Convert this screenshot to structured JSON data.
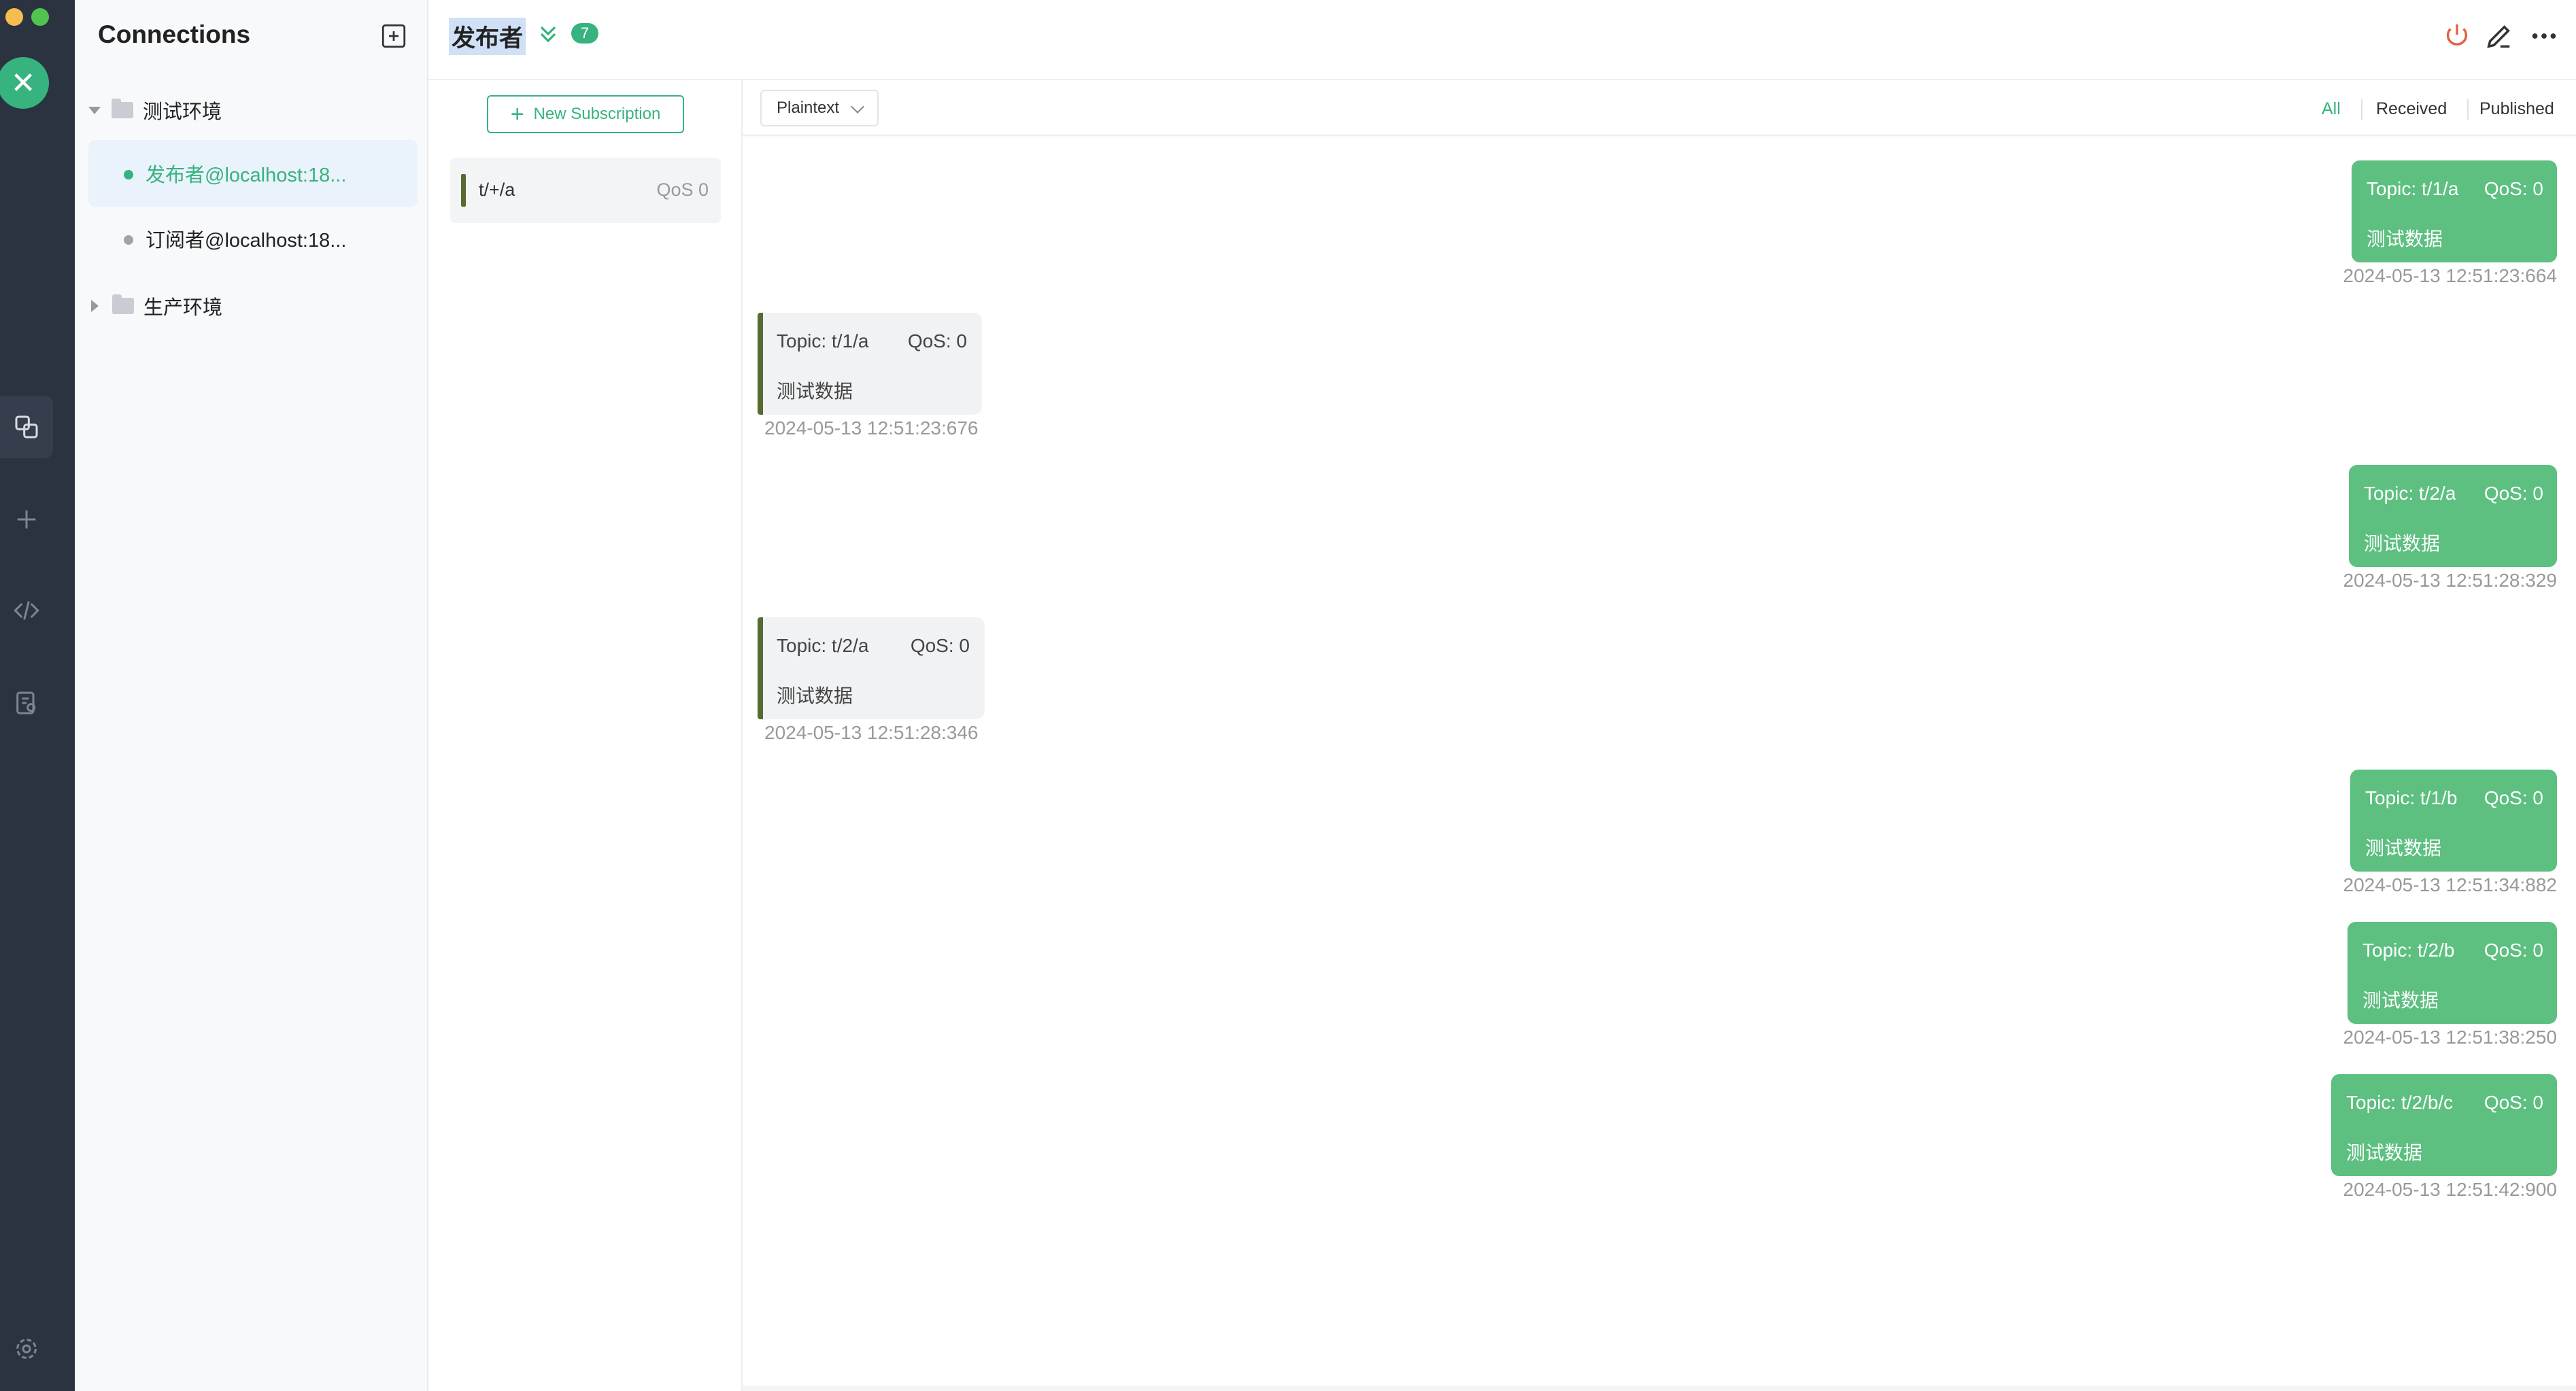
{
  "sidebar": {
    "logo": "✕",
    "icons": [
      "connections-icon",
      "plus-icon",
      "script-icon",
      "log-icon",
      "settings-icon"
    ]
  },
  "connections": {
    "title": "Connections",
    "groups": [
      {
        "name": "测试环境",
        "expanded": true
      },
      {
        "name": "生产环境",
        "expanded": false
      }
    ],
    "items": [
      {
        "name": "发布者@localhost:18...",
        "status": "connected",
        "active": true
      },
      {
        "name": "订阅者@localhost:18...",
        "status": "disconnected",
        "active": false
      }
    ]
  },
  "header": {
    "title": "发布者",
    "count": "7"
  },
  "subscriptions": {
    "new_label": "New Subscription",
    "items": [
      {
        "topic": "t/+/a",
        "qos": "QoS 0",
        "color": "#556b2f"
      }
    ]
  },
  "messages": {
    "format": "Plaintext",
    "filters": [
      "All",
      "Received",
      "Published"
    ],
    "items": [
      {
        "dir": "out",
        "topic": "Topic: t/1/a",
        "qos": "QoS: 0",
        "payload": "测试数据",
        "time": "2024-05-13 12:51:23:664"
      },
      {
        "dir": "in",
        "topic": "Topic: t/1/a",
        "qos": "QoS: 0",
        "payload": "测试数据",
        "time": "2024-05-13 12:51:23:676"
      },
      {
        "dir": "out",
        "topic": "Topic: t/2/a",
        "qos": "QoS: 0",
        "payload": "测试数据",
        "time": "2024-05-13 12:51:28:329"
      },
      {
        "dir": "in",
        "topic": "Topic: t/2/a",
        "qos": "QoS: 0",
        "payload": "测试数据",
        "time": "2024-05-13 12:51:28:346"
      },
      {
        "dir": "out",
        "topic": "Topic: t/1/b",
        "qos": "QoS: 0",
        "payload": "测试数据",
        "time": "2024-05-13 12:51:34:882"
      },
      {
        "dir": "out",
        "topic": "Topic: t/2/b",
        "qos": "QoS: 0",
        "payload": "测试数据",
        "time": "2024-05-13 12:51:38:250"
      },
      {
        "dir": "out",
        "topic": "Topic: t/2/b/c",
        "qos": "QoS: 0",
        "payload": "测试数据",
        "time": "2024-05-13 12:51:42:900"
      }
    ]
  },
  "colors": {
    "accent": "#36b37e",
    "out_bubble": "#5dbf80",
    "in_bubble": "#f1f2f4",
    "rail": "#2b3340"
  }
}
